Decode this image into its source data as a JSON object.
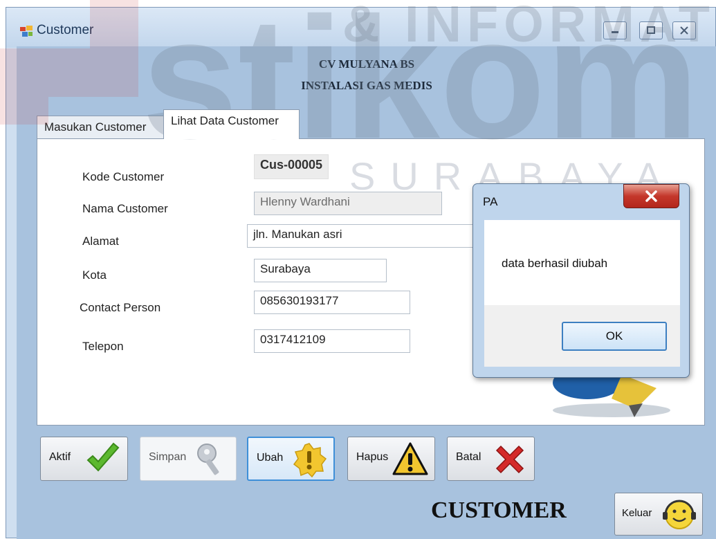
{
  "window": {
    "title": "Customer",
    "app_icon": "window-app-icon"
  },
  "header": {
    "line1": "CV MULYANA BS",
    "line2": "INSTALASI GAS MEDIS"
  },
  "tabs": [
    {
      "label": "Masukan Customer",
      "active": false
    },
    {
      "label": "Lihat Data Customer",
      "active": true
    }
  ],
  "form": {
    "kode_label": "Kode Customer",
    "kode_value": "Cus-00005",
    "nama_label": "Nama Customer",
    "nama_value": "Hlenny Wardhani",
    "alamat_label": "Alamat",
    "alamat_value": "jln. Manukan asri",
    "kota_label": "Kota",
    "kota_value": "Surabaya",
    "cp_label": "Contact Person",
    "cp_value": "085630193177",
    "telepon_label": "Telepon",
    "telepon_value": "0317412109"
  },
  "toolbar": {
    "aktif": "Aktif",
    "simpan": "Simpan",
    "ubah": "Ubah",
    "hapus": "Hapus",
    "batal": "Batal"
  },
  "footer": {
    "title": "CUSTOMER",
    "exit_label": "Keluar"
  },
  "dialog": {
    "title": "PA",
    "message": "data berhasil diubah",
    "ok_label": "OK"
  },
  "watermark": {
    "line1": "& INFORMATIKA",
    "main": "stikom",
    "city": "SURABAYA"
  },
  "colors": {
    "accent": "#3c7fc1",
    "close_red": "#c4372b",
    "window_bg": "#a8c2de"
  }
}
